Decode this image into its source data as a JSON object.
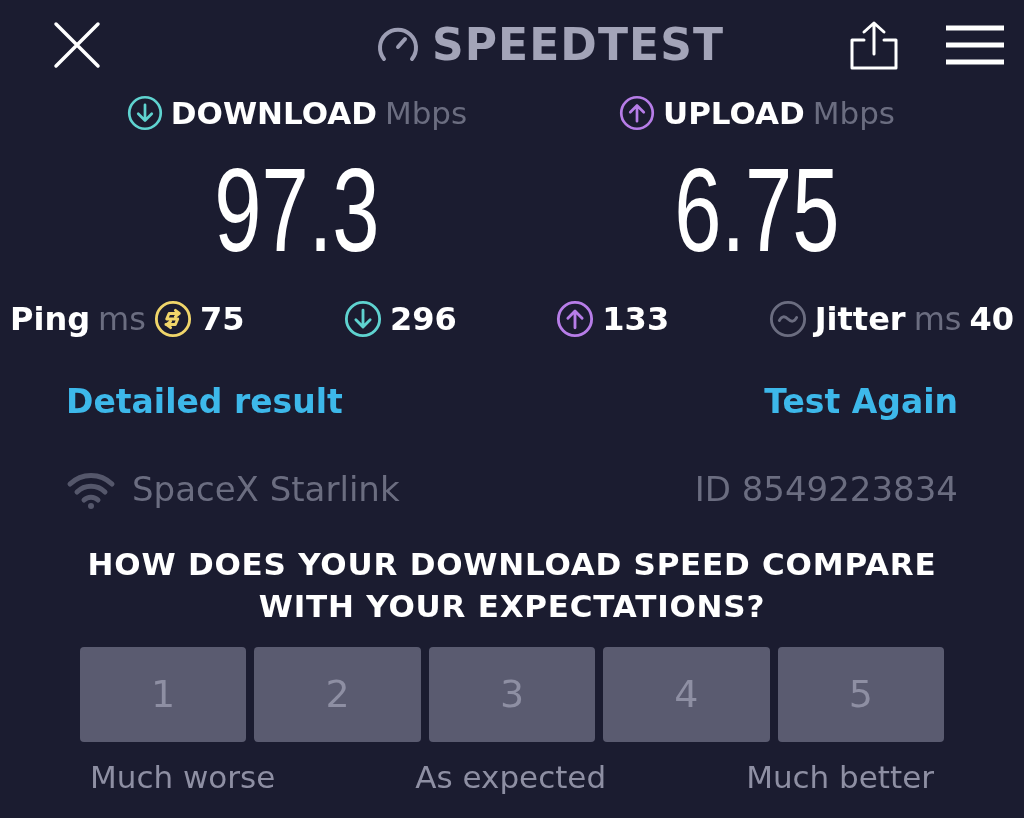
{
  "header": {
    "title": "SPEEDTEST"
  },
  "results": [
    {
      "kind": "download",
      "label": "DOWNLOAD",
      "unit": "Mbps",
      "value": "97.3"
    },
    {
      "kind": "upload",
      "label": "UPLOAD",
      "unit": "Mbps",
      "value": "6.75"
    }
  ],
  "stats": [
    {
      "kind": "ping",
      "label": "Ping",
      "unit": "ms",
      "value": "75"
    },
    {
      "kind": "download",
      "value": "296"
    },
    {
      "kind": "upload",
      "value": "133"
    },
    {
      "kind": "jitter",
      "label": "Jitter",
      "unit": "ms",
      "value": "40"
    }
  ],
  "links": [
    "Detailed result",
    "Test Again"
  ],
  "connection": {
    "provider": "SpaceX Starlink",
    "id": "ID 8549223834"
  },
  "survey": {
    "question": "HOW DOES YOUR DOWNLOAD SPEED COMPARE WITH YOUR EXPECTATIONS?",
    "options": [
      {
        "label": "1",
        "selected": false
      },
      {
        "label": "2",
        "selected": false
      },
      {
        "label": "3",
        "selected": false
      },
      {
        "label": "4",
        "selected": false
      },
      {
        "label": "5",
        "selected": false
      }
    ],
    "scale_labels": [
      "Much worse",
      "As expected",
      "Much better"
    ]
  }
}
